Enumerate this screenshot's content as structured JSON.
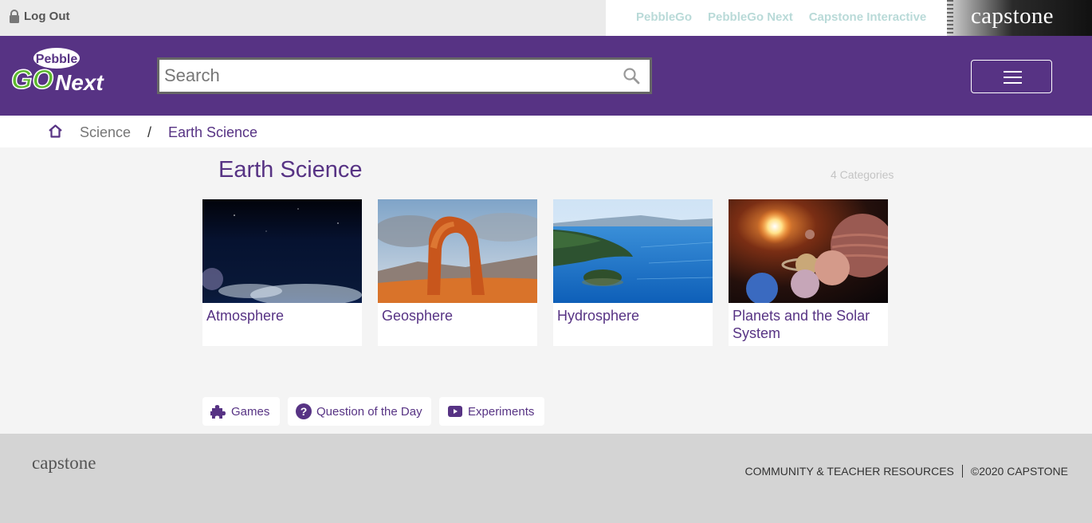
{
  "topbar": {
    "logout_label": "Log Out",
    "links": [
      "PebbleGo",
      "PebbleGo Next",
      "Capstone Interactive"
    ],
    "brand": "capstone"
  },
  "header": {
    "logo": {
      "top": "Pebble",
      "main": "GO",
      "suffix": "Next"
    },
    "search_placeholder": "Search"
  },
  "breadcrumb": {
    "parent": "Science",
    "separator": "/",
    "current": "Earth Science"
  },
  "main": {
    "title": "Earth Science",
    "count_label": "4 Categories",
    "categories": [
      {
        "label": "Atmosphere",
        "image": "earth-atmosphere-image"
      },
      {
        "label": "Geosphere",
        "image": "rock-arch-image"
      },
      {
        "label": "Hydrosphere",
        "image": "lake-island-image"
      },
      {
        "label": "Planets and the Solar System",
        "image": "solar-system-image"
      }
    ]
  },
  "extras": [
    {
      "label": "Games",
      "icon": "puzzle-icon"
    },
    {
      "label": "Question of the Day",
      "icon": "question-icon"
    },
    {
      "label": "Experiments",
      "icon": "video-icon"
    }
  ],
  "footer": {
    "brand": "capstone",
    "resources_label": "COMMUNITY & TEACHER RESOURCES",
    "copyright": "©2020 CAPSTONE"
  },
  "colors": {
    "brand_purple": "#573384",
    "logo_green": "#5cb82e",
    "top_link": "#b9dad8"
  }
}
